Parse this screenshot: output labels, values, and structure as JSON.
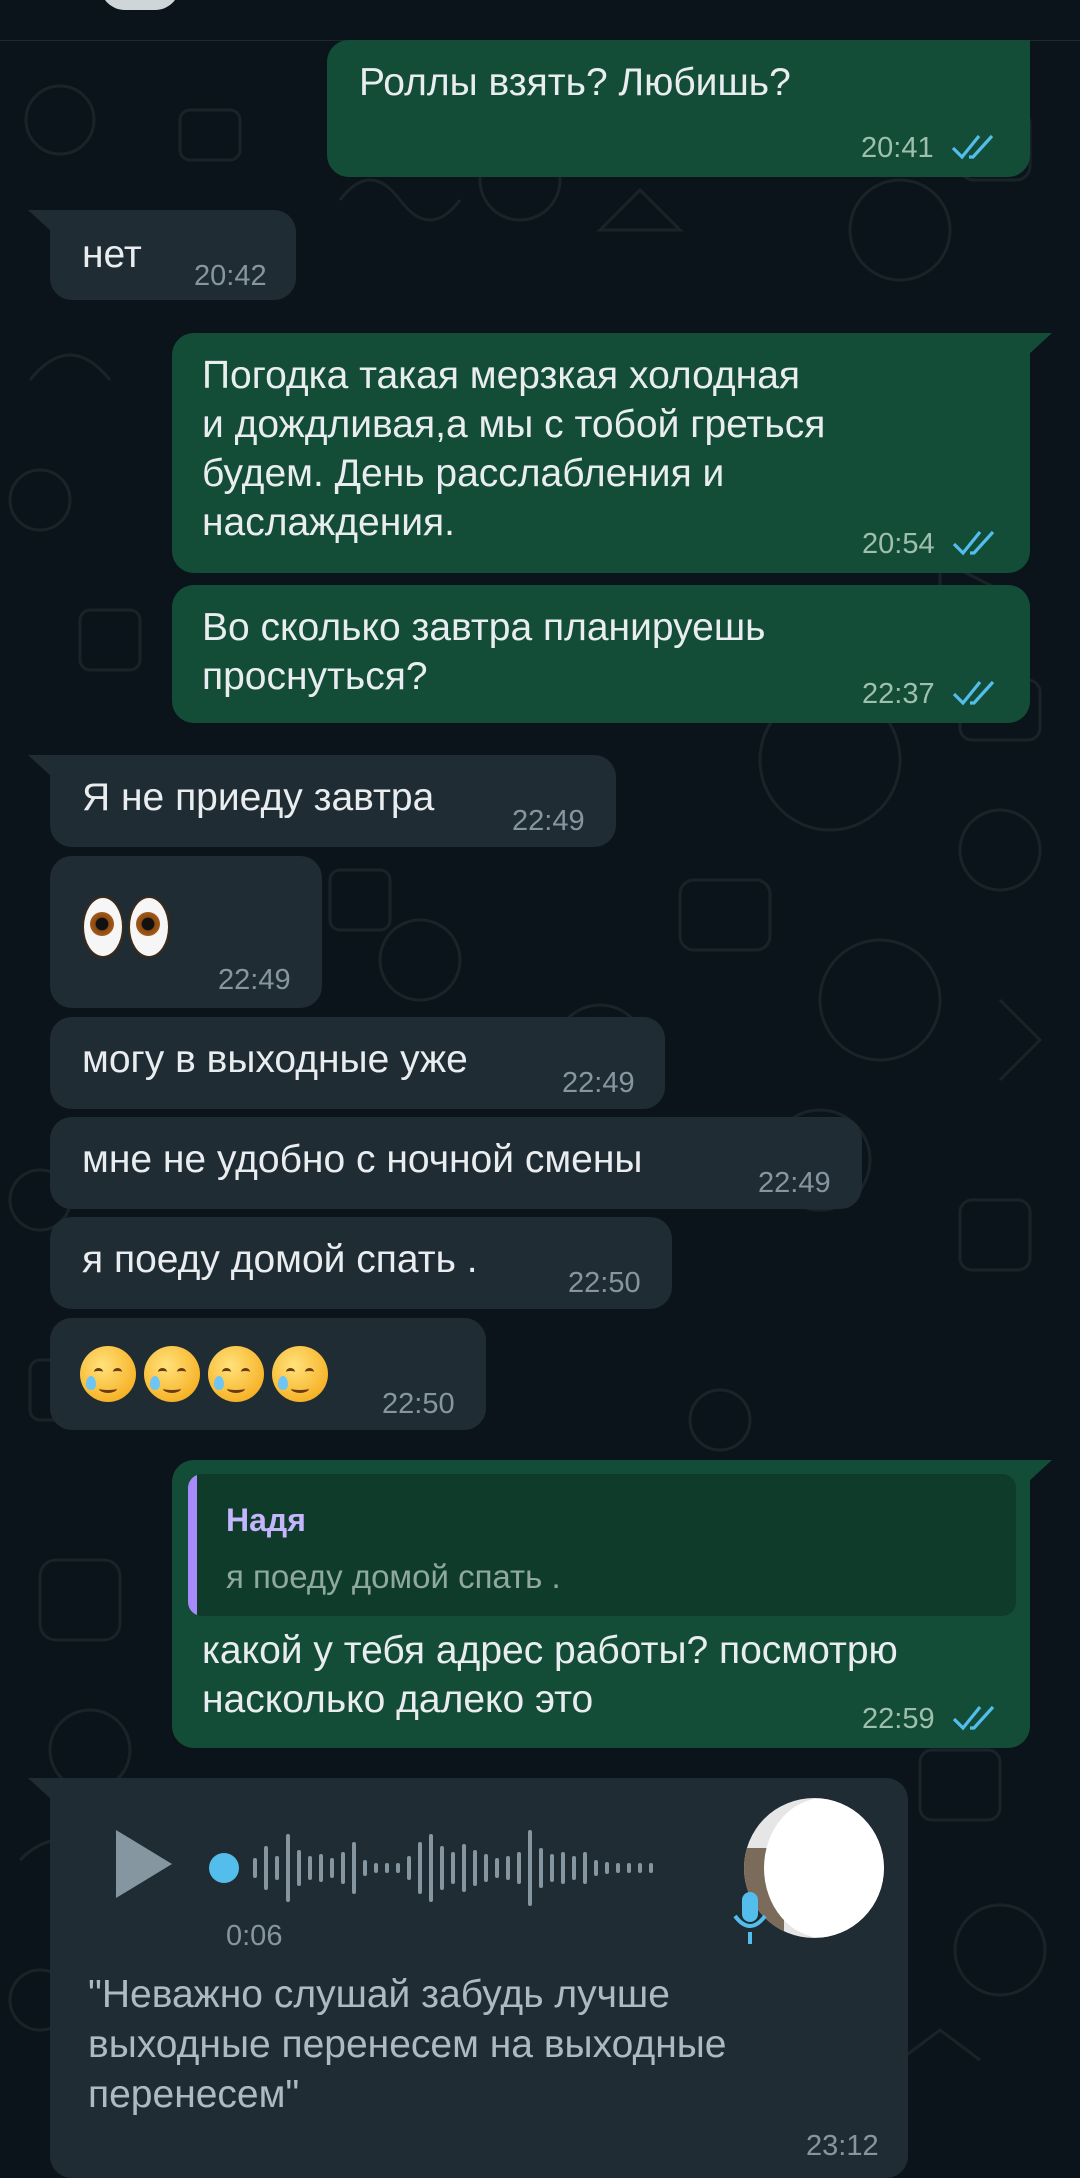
{
  "messages": [
    {
      "id": "m1",
      "dir": "out",
      "text": "Роллы взять? Любишь?",
      "time": "20:41",
      "read": true
    },
    {
      "id": "m2",
      "dir": "in",
      "text": "нет",
      "time": "20:42"
    },
    {
      "id": "m3",
      "dir": "out",
      "text": "Погодка такая мерзкая холодная\nи дождливая,а мы с тобой греться\nбудем. День расслабления и\nнаслаждения.",
      "time": "20:54",
      "read": true
    },
    {
      "id": "m4",
      "dir": "out",
      "text": "Во сколько завтра планируешь\nпроснуться?",
      "time": "22:37",
      "read": true
    },
    {
      "id": "m5",
      "dir": "in",
      "text": "Я не приеду завтра",
      "time": "22:49"
    },
    {
      "id": "m6",
      "dir": "in",
      "emoji": "eyes",
      "time": "22:49"
    },
    {
      "id": "m7",
      "dir": "in",
      "text": "могу в выходные уже",
      "time": "22:49"
    },
    {
      "id": "m8",
      "dir": "in",
      "text": "мне не удобно с ночной смены",
      "time": "22:49"
    },
    {
      "id": "m9",
      "dir": "in",
      "text": "я поеду домой спать .",
      "time": "22:50"
    },
    {
      "id": "m10",
      "dir": "in",
      "emoji": "crying-faces",
      "emoji_count": 4,
      "time": "22:50"
    },
    {
      "id": "m11",
      "dir": "out",
      "reply": {
        "name": "Надя",
        "text": "я поеду домой спать ."
      },
      "text": "какой у тебя адрес работы? посмотрю\nнасколько далеко это",
      "time": "22:59",
      "read": true
    }
  ],
  "voice": {
    "duration": "0:06",
    "transcript": "\"Неважно слушай забудь лучше\nвыходные перенесем на выходные\nперенесем\"",
    "time": "23:12",
    "icons": {
      "play": "play-icon",
      "mic": "mic-icon"
    }
  },
  "colors": {
    "background": "#0b141a",
    "outgoing_bubble": "#144d37",
    "incoming_bubble": "#202c33",
    "read_ticks": "#53bdeb",
    "reply_accent": "#a78bfa"
  }
}
